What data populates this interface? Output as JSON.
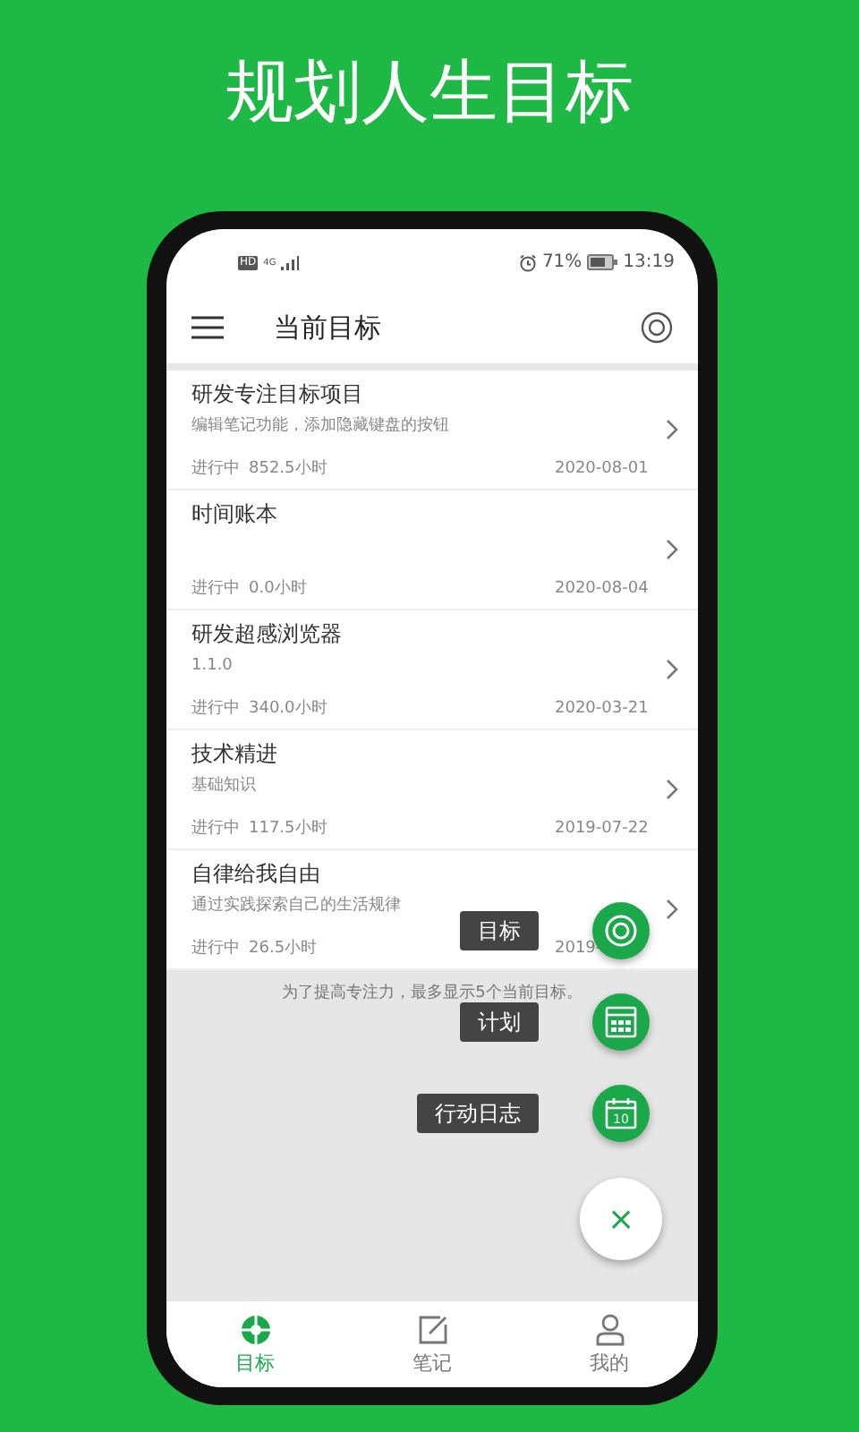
{
  "headline": "规划人生目标",
  "status_bar": {
    "badge": "HD",
    "network": "4G",
    "battery": "71%",
    "time": "13:19"
  },
  "app_bar": {
    "title": "当前目标"
  },
  "goals": [
    {
      "title": "研发专注目标项目",
      "note": "编辑笔记功能，添加隐藏键盘的按钮",
      "status": "进行中",
      "hours": "852.5小时",
      "date": "2020-08-01"
    },
    {
      "title": "时间账本",
      "status": "进行中",
      "hours": "0.0小时",
      "date": "2020-08-04"
    },
    {
      "title": "研发超感浏览器",
      "note": "1.1.0",
      "status": "进行中",
      "hours": "340.0小时",
      "date": "2020-03-21"
    },
    {
      "title": "技术精进",
      "note": "基础知识",
      "status": "进行中",
      "hours": "117.5小时",
      "date": "2019-07-22"
    },
    {
      "title": "自律给我自由",
      "note": "通过实践探索自己的生活规律",
      "status": "进行中",
      "hours": "26.5小时",
      "date": "2019-"
    }
  ],
  "hint": "为了提高专注力，最多显示5个当前目标。",
  "fab_menu": [
    {
      "kind": "target",
      "label": "目标"
    },
    {
      "kind": "plan",
      "label": "计划"
    },
    {
      "kind": "log",
      "label": "行动日志",
      "badge": "10"
    }
  ],
  "close_button": {
    "label": "×"
  },
  "bottom_nav": [
    {
      "kind": "goals",
      "label": "目标",
      "selected": true
    },
    {
      "kind": "notes",
      "label": "笔记",
      "selected": false
    },
    {
      "kind": "me",
      "label": "我的",
      "selected": false
    }
  ]
}
